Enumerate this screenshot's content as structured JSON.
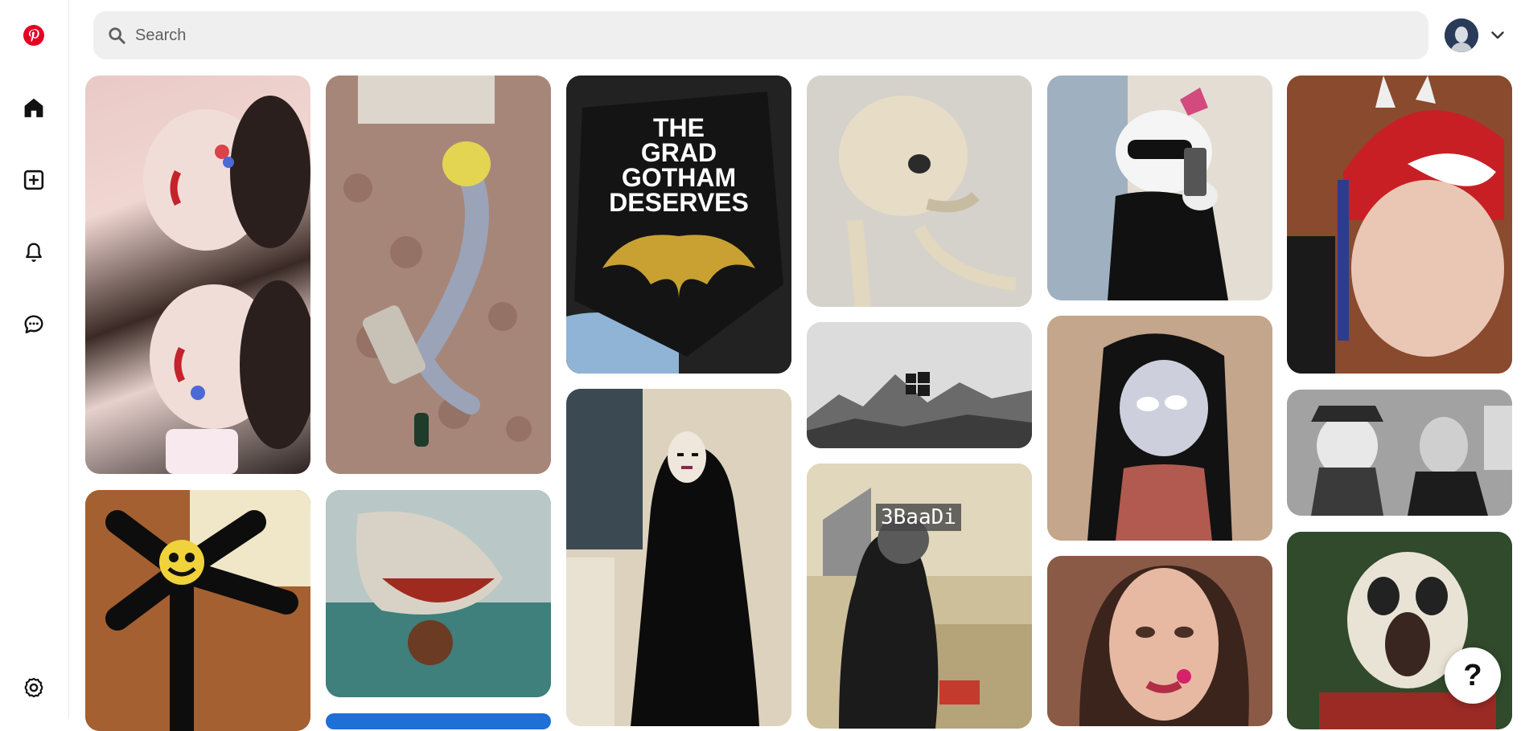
{
  "brand": {
    "logo": "pinterest-logo",
    "color": "#e60023"
  },
  "sidebar": {
    "items": [
      {
        "name": "home",
        "icon": "home-icon"
      },
      {
        "name": "create",
        "icon": "plus-square-icon"
      },
      {
        "name": "notifications",
        "icon": "bell-icon"
      },
      {
        "name": "messages",
        "icon": "chat-icon"
      }
    ],
    "settings": {
      "icon": "gear-icon"
    }
  },
  "search": {
    "placeholder": "Search",
    "value": ""
  },
  "account": {
    "avatar": "user-avatar",
    "chevron": "chevron-down-icon"
  },
  "pins": [
    {
      "id": 1,
      "desc": "two people with clown makeup"
    },
    {
      "id": 2,
      "desc": "plush toy lying on sofa with bottle"
    },
    {
      "id": 3,
      "desc": "graduation cap with batman logo",
      "caption": "THE\nGRAD\nGOTHAM\nDESERVES"
    },
    {
      "id": 4,
      "desc": "skeleton close-up"
    },
    {
      "id": 5,
      "desc": "hello kitty costume mirror selfie"
    },
    {
      "id": 6,
      "desc": "person wearing crocheted spider-man hat"
    },
    {
      "id": 7,
      "desc": "black figure toy on wooden table"
    },
    {
      "id": 8,
      "desc": "shark with face in water"
    },
    {
      "id": 9,
      "desc": "no-face costume"
    },
    {
      "id": 10,
      "desc": "mountains with windows logo"
    },
    {
      "id": 11,
      "desc": "person cooking in kitchen",
      "caption": "3BaaDi"
    },
    {
      "id": 12,
      "desc": "cartoon girl with dark hair"
    },
    {
      "id": 13,
      "desc": "black and white photo of two people in uniform"
    },
    {
      "id": 14,
      "desc": "woman with red nails"
    },
    {
      "id": 15,
      "desc": "panda cartoon shouting"
    },
    {
      "id": 16,
      "desc": "blue image partially visible"
    }
  ],
  "help": {
    "label": "?"
  }
}
